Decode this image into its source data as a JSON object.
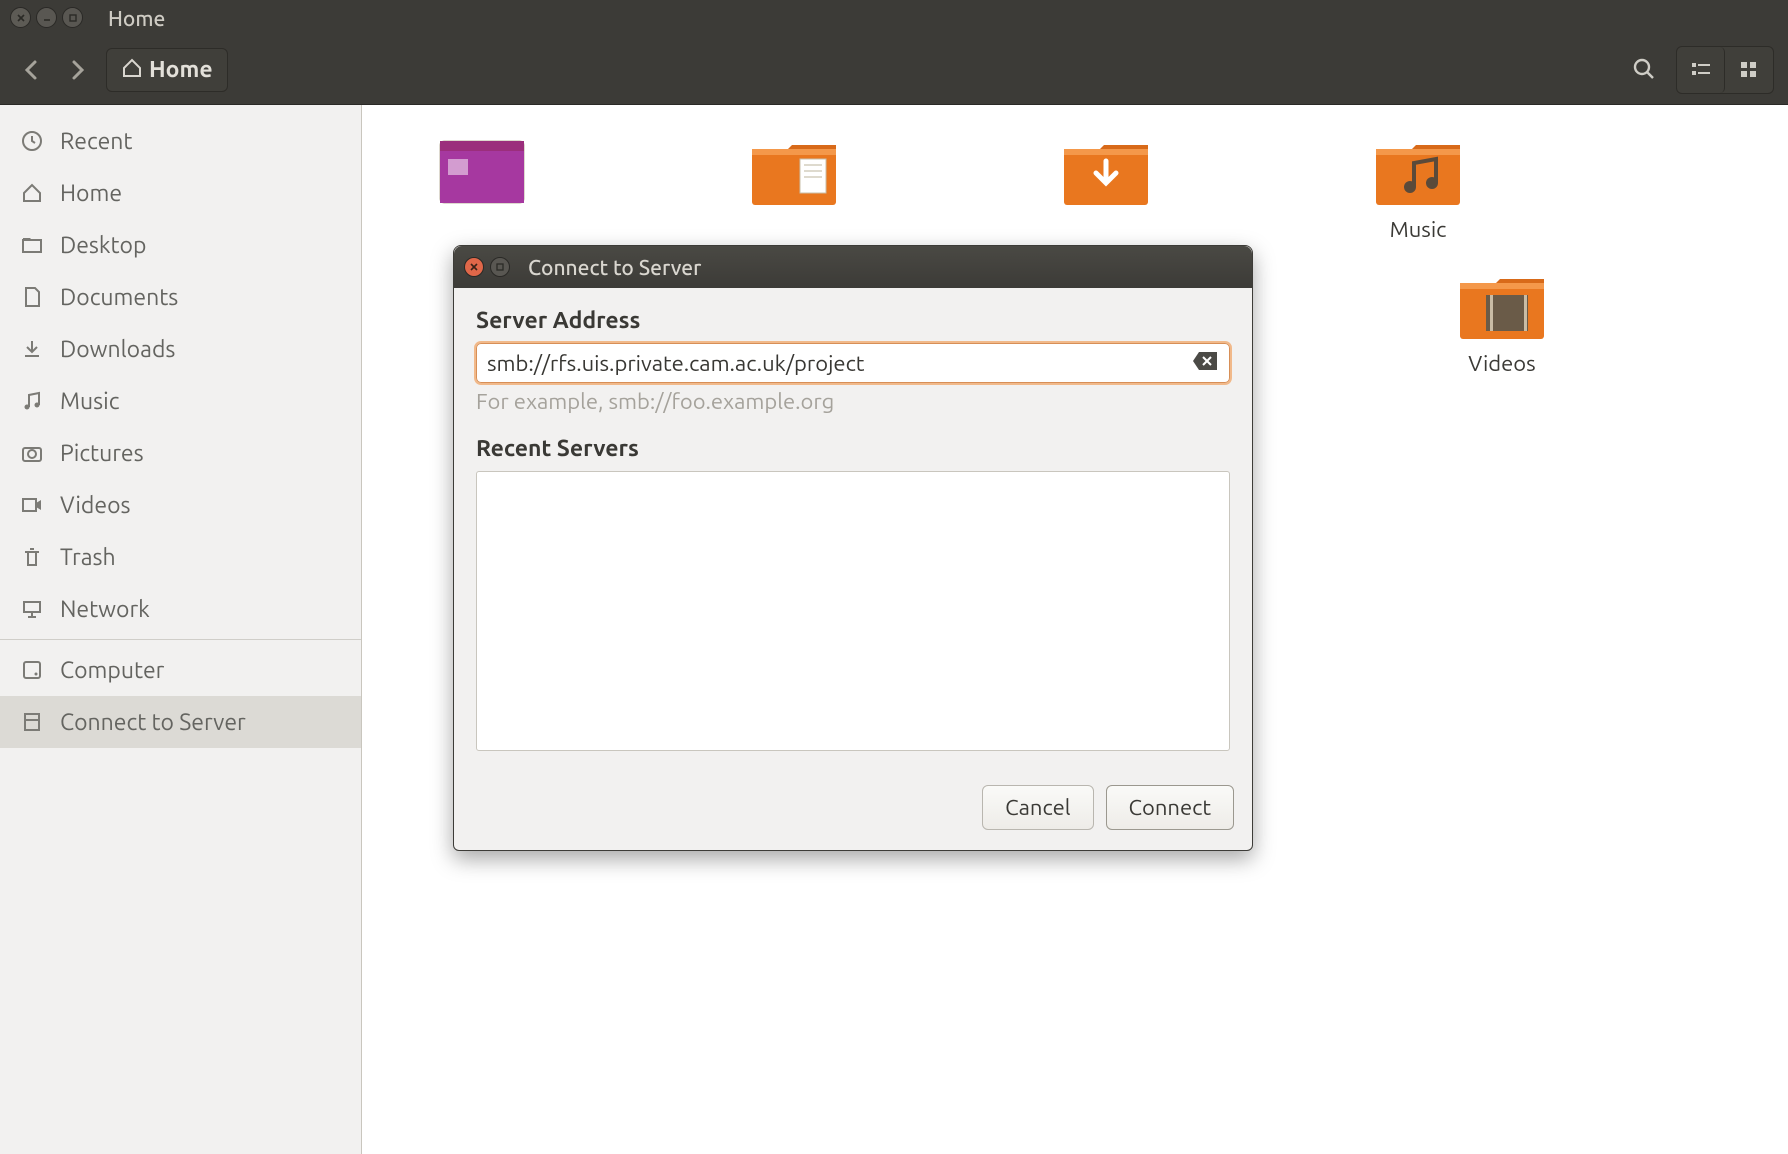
{
  "window": {
    "title": "Home"
  },
  "toolbar": {
    "location": "Home"
  },
  "sidebar": {
    "items": [
      "Recent",
      "Home",
      "Desktop",
      "Documents",
      "Downloads",
      "Music",
      "Pictures",
      "Videos",
      "Trash",
      "Network"
    ],
    "other": [
      "Computer",
      "Connect to Server"
    ]
  },
  "files": {
    "music": "Music",
    "videos": "Videos"
  },
  "dialog": {
    "title": "Connect to Server",
    "section_address": "Server Address",
    "address_value": "smb://rfs.uis.private.cam.ac.uk/project",
    "hint": "For example, smb://foo.example.org",
    "section_recent": "Recent Servers",
    "cancel": "Cancel",
    "connect": "Connect"
  }
}
